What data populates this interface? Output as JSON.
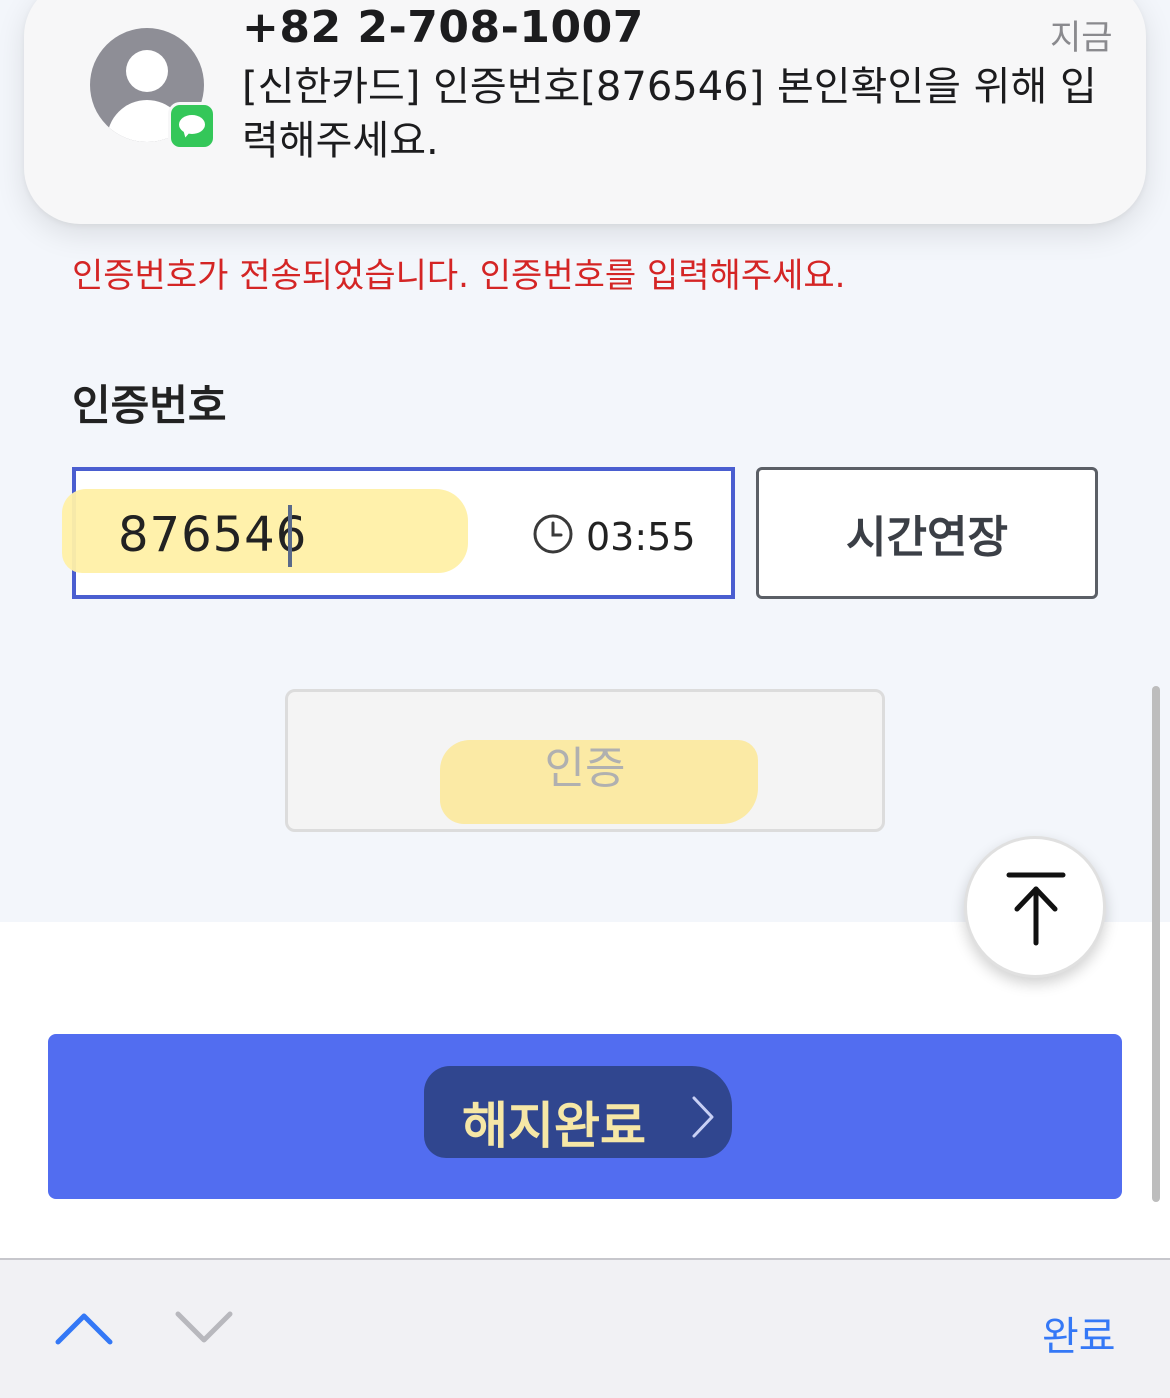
{
  "notification": {
    "sender": "+82 2-708-1007",
    "time": "지금",
    "body": "[신한카드] 인증번호[876546] 본인확인을 위해 입력해주세요."
  },
  "form": {
    "error_message": "인증번호가 전송되었습니다. 인증번호를 입력해주세요.",
    "code_label": "인증번호",
    "code_value": "876546",
    "timer": "03:55",
    "extend_button": "시간연장",
    "verify_button": "인증"
  },
  "actions": {
    "complete_button": "해지완료"
  },
  "keyboard_toolbar": {
    "done_label": "완료"
  },
  "colors": {
    "primary": "#526df0",
    "error": "#d42525",
    "input_border": "#4a5ed0",
    "done_link": "#3478f6"
  },
  "icons": {
    "avatar": "contact-avatar-icon",
    "badge": "messages-app-icon",
    "clock": "clock-icon",
    "scroll_top": "arrow-up-to-top-icon",
    "chevron_right": "chevron-right-icon",
    "prev": "chevron-up-icon",
    "next": "chevron-down-icon"
  }
}
